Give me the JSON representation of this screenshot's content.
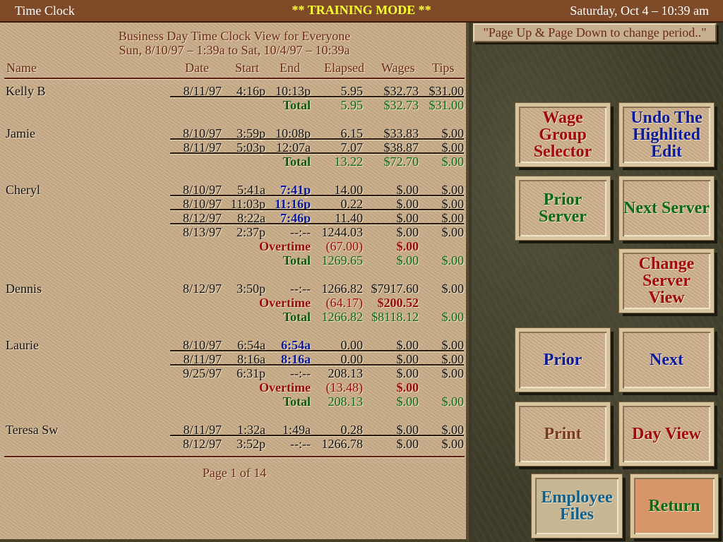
{
  "titlebar": {
    "app_name": "Time Clock",
    "mode": "** TRAINING MODE **",
    "datetime": "Saturday, Oct 4 – 10:39 am"
  },
  "report": {
    "title": "Business Day Time Clock View for Everyone",
    "period": "Sun, 8/10/97 – 1:39a  to  Sat, 10/4/97 – 10:39a",
    "columns": {
      "name": "Name",
      "date": "Date",
      "start": "Start",
      "end": "End",
      "elapsed": "Elapsed",
      "wages": "Wages",
      "tips": "Tips"
    },
    "page_label": "Page 1 of 14"
  },
  "rows": [
    {
      "type": "entry",
      "name": "Kelly B",
      "date": "8/11/97",
      "start": "4:16p",
      "end": "10:13p",
      "elapsed": "5.95",
      "wages": "$32.73",
      "tips": "$31.00",
      "ruled": true
    },
    {
      "type": "total",
      "label": "Total",
      "elapsed": "5.95",
      "wages": "$32.73",
      "tips": "$31.00"
    },
    {
      "type": "gap"
    },
    {
      "type": "entry",
      "name": "Jamie",
      "date": "8/10/97",
      "start": "3:59p",
      "end": "10:08p",
      "elapsed": "6.15",
      "wages": "$33.83",
      "tips": "$.00",
      "ruled": true
    },
    {
      "type": "entry",
      "name": "",
      "date": "8/11/97",
      "start": "5:03p",
      "end": "12:07a",
      "elapsed": "7.07",
      "wages": "$38.87",
      "tips": "$.00",
      "ruled": true
    },
    {
      "type": "total",
      "label": "Total",
      "elapsed": "13.22",
      "wages": "$72.70",
      "tips": "$.00"
    },
    {
      "type": "gap"
    },
    {
      "type": "entry",
      "name": "Cheryl",
      "date": "8/10/97",
      "start": "5:41a",
      "end": "7:41p",
      "end_highlight": true,
      "elapsed": "14.00",
      "wages": "$.00",
      "tips": "$.00",
      "ruled": true
    },
    {
      "type": "entry",
      "name": "",
      "date": "8/10/97",
      "start": "11:03p",
      "end": "11:16p",
      "end_highlight": true,
      "elapsed": "0.22",
      "wages": "$.00",
      "tips": "$.00",
      "ruled": true
    },
    {
      "type": "entry",
      "name": "",
      "date": "8/12/97",
      "start": "8:22a",
      "end": "7:46p",
      "end_highlight": true,
      "elapsed": "11.40",
      "wages": "$.00",
      "tips": "$.00",
      "ruled": true
    },
    {
      "type": "entry",
      "name": "",
      "date": "8/13/97",
      "start": "2:37p",
      "end": "--:--",
      "elapsed": "1244.03",
      "wages": "$.00",
      "tips": "$.00"
    },
    {
      "type": "overtime",
      "label": "Overtime",
      "elapsed": "(67.00)",
      "wages": "$.00",
      "tips": ""
    },
    {
      "type": "total",
      "label": "Total",
      "elapsed": "1269.65",
      "wages": "$.00",
      "tips": "$.00"
    },
    {
      "type": "gap"
    },
    {
      "type": "entry",
      "name": "Dennis",
      "date": "8/12/97",
      "start": "3:50p",
      "end": "--:--",
      "elapsed": "1266.82",
      "wages": "$7917.60",
      "tips": "$.00"
    },
    {
      "type": "overtime",
      "label": "Overtime",
      "elapsed": "(64.17)",
      "wages": "$200.52",
      "tips": ""
    },
    {
      "type": "total",
      "label": "Total",
      "elapsed": "1266.82",
      "wages": "$8118.12",
      "tips": "$.00"
    },
    {
      "type": "gap"
    },
    {
      "type": "entry",
      "name": "Laurie",
      "date": "8/10/97",
      "start": "6:54a",
      "end": "6:54a",
      "end_highlight": true,
      "elapsed": "0.00",
      "wages": "$.00",
      "tips": "$.00",
      "ruled": true
    },
    {
      "type": "entry",
      "name": "",
      "date": "8/11/97",
      "start": "8:16a",
      "end": "8:16a",
      "end_highlight": true,
      "elapsed": "0.00",
      "wages": "$.00",
      "tips": "$.00",
      "ruled": true
    },
    {
      "type": "entry",
      "name": "",
      "date": "9/25/97",
      "start": "6:31p",
      "end": "--:--",
      "elapsed": "208.13",
      "wages": "$.00",
      "tips": "$.00"
    },
    {
      "type": "overtime",
      "label": "Overtime",
      "elapsed": "(13.48)",
      "wages": "$.00",
      "tips": ""
    },
    {
      "type": "total",
      "label": "Total",
      "elapsed": "208.13",
      "wages": "$.00",
      "tips": "$.00"
    },
    {
      "type": "gap"
    },
    {
      "type": "entry",
      "name": "Teresa Sw",
      "date": "8/11/97",
      "start": "1:32a",
      "end": "1:49a",
      "elapsed": "0.28",
      "wages": "$.00",
      "tips": "$.00",
      "ruled": true
    },
    {
      "type": "entry",
      "name": "",
      "date": "8/12/97",
      "start": "3:52p",
      "end": "--:--",
      "elapsed": "1266.78",
      "wages": "$.00",
      "tips": "$.00"
    }
  ],
  "hint": "\"Page Up & Page Down to change period..\"",
  "buttons": {
    "wage_group": "Wage Group Selector",
    "undo_edit": "Undo The Highlited Edit",
    "prior_server": "Prior Server",
    "next_server": "Next Server",
    "change_view": "Change Server View",
    "prior": "Prior",
    "next": "Next",
    "print": "Print",
    "day_view": "Day View",
    "employee_files": "Employee Files",
    "return": "Return"
  }
}
